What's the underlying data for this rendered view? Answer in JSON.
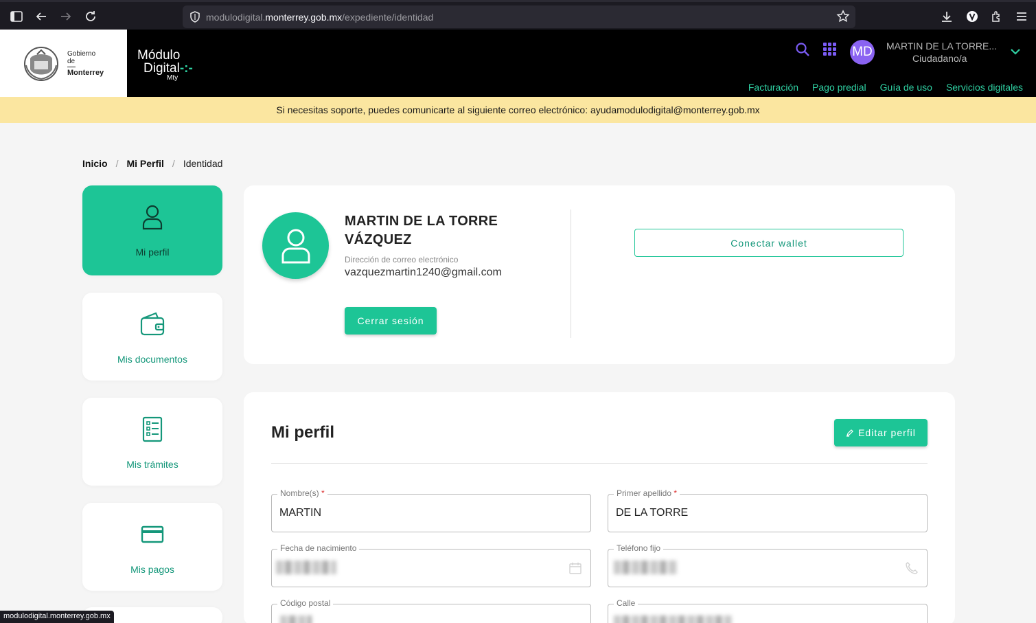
{
  "browser": {
    "url_host_prefix": "modulodigital.",
    "url_host_main": "monterrey.gob.mx",
    "url_path": "/expediente/identidad",
    "status_url": "modulodigital.monterrey.gob.mx"
  },
  "header": {
    "gov_line1": "Gobierno",
    "gov_line2": "de",
    "gov_city": "Monterrey",
    "brand_line1": "Módulo",
    "brand_line2": "Digital",
    "brand_line3": "Mty",
    "avatar_initials": "MD",
    "user_name": "MARTIN DE LA TORRE...",
    "user_role": "Ciudadano/a",
    "nav": [
      "Facturación",
      "Pago predial",
      "Guía de uso",
      "Servicios digitales"
    ]
  },
  "banner": {
    "text": "Si necesitas soporte, puedes comunicarte al siguiente correo electrónico: ayudamodulodigital@monterrey.gob.mx"
  },
  "breadcrumb": {
    "home": "Inicio",
    "profile": "Mi Perfil",
    "current": "Identidad"
  },
  "sidebar": {
    "items": [
      {
        "label": "Mi perfil",
        "icon": "user-icon",
        "active": true
      },
      {
        "label": "Mis documentos",
        "icon": "wallet-icon",
        "active": false
      },
      {
        "label": "Mis trámites",
        "icon": "checklist-icon",
        "active": false
      },
      {
        "label": "Mis pagos",
        "icon": "credit-card-icon",
        "active": false
      }
    ]
  },
  "profile": {
    "full_name_line1": "MARTIN DE LA TORRE",
    "full_name_line2": "VÁZQUEZ",
    "email_label": "Dirección de correo electrónico",
    "email": "vazquezmartin1240@gmail.com",
    "logout_label": "Cerrar sesión",
    "wallet_label": "Conectar wallet"
  },
  "form": {
    "title": "Mi perfil",
    "edit_label": "Editar perfil",
    "fields": {
      "nombre": {
        "label": "Nombre(s)",
        "value": "MARTIN",
        "required": "*"
      },
      "apellido": {
        "label": "Primer apellido",
        "value": "DE LA TORRE",
        "required": "*"
      },
      "nacimiento": {
        "label": "Fecha de nacimiento"
      },
      "telefono": {
        "label": "Teléfono fijo"
      },
      "postal": {
        "label": "Código postal"
      },
      "calle": {
        "label": "Calle"
      }
    }
  },
  "colors": {
    "accent": "#1dc596",
    "accent_text": "#14977a",
    "nav_green": "#2fd1a3",
    "avatar_purple": "#8a63f2",
    "banner": "#fbe6a0"
  }
}
